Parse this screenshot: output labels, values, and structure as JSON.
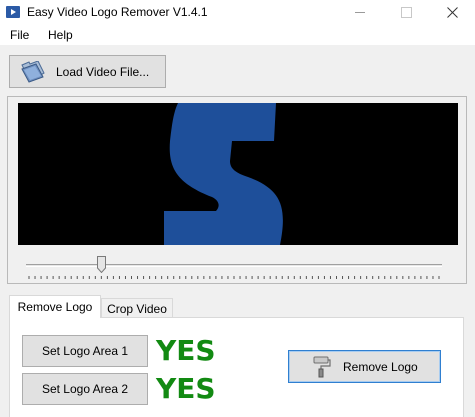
{
  "window": {
    "title": "Easy Video Logo Remover V1.4.1"
  },
  "menu": {
    "file": "File",
    "help": "Help"
  },
  "toolbar": {
    "load_label": "Load Video File..."
  },
  "video": {
    "frame_letter": "S",
    "letter_color": "#1e4f9a",
    "background_color": "#000000",
    "seek_position_fraction": 0.18
  },
  "tabs": [
    {
      "label": "Remove Logo",
      "selected": true
    },
    {
      "label": "Crop Video",
      "selected": false
    }
  ],
  "remove_logo": {
    "area1_label": "Set Logo Area 1",
    "area1_status": "YES",
    "area2_label": "Set Logo Area 2",
    "area2_status": "YES",
    "status_color": "#128a12",
    "remove_label": "Remove Logo"
  },
  "icons": {
    "app": "app-video-icon",
    "load": "folder-open-icon",
    "remove": "paint-roller-icon"
  }
}
